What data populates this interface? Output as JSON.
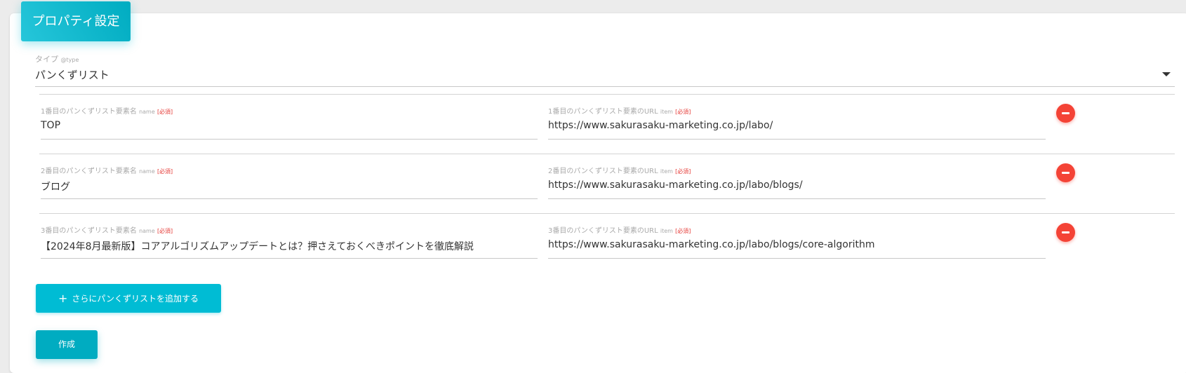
{
  "header": {
    "title": "プロパティ設定"
  },
  "type_field": {
    "label": "タイプ",
    "sub_label": "@type",
    "value": "パンくずリスト"
  },
  "breadcrumb_items": [
    {
      "name_label": "1番目のパンくずリスト要素名",
      "name_attr": "name",
      "name_required": "[必須]",
      "name_value": "TOP",
      "url_label": "1番目のパンくずリスト要素のURL",
      "url_attr": "item",
      "url_required": "[必須]",
      "url_value": "https://www.sakurasaku-marketing.co.jp/labo/"
    },
    {
      "name_label": "2番目のパンくずリスト要素名",
      "name_attr": "name",
      "name_required": "[必須]",
      "name_value": "ブログ",
      "url_label": "2番目のパンくずリスト要素のURL",
      "url_attr": "item",
      "url_required": "[必須]",
      "url_value": "https://www.sakurasaku-marketing.co.jp/labo/blogs/"
    },
    {
      "name_label": "3番目のパンくずリスト要素名",
      "name_attr": "name",
      "name_required": "[必須]",
      "name_value": "【2024年8月最新版】コアアルゴリズムアップデートとは？押さえておくべきポイントを徹底解説",
      "url_label": "3番目のパンくずリスト要素のURL",
      "url_attr": "item",
      "url_required": "[必須]",
      "url_value": "https://www.sakurasaku-marketing.co.jp/labo/blogs/core-algorithm"
    }
  ],
  "buttons": {
    "add_label": "さらにパンくずリストを追加する",
    "add_icon": "+",
    "create_label": "作成"
  },
  "colors": {
    "accent": "#00bcd4",
    "danger": "#f44336",
    "required": "#e53935"
  }
}
